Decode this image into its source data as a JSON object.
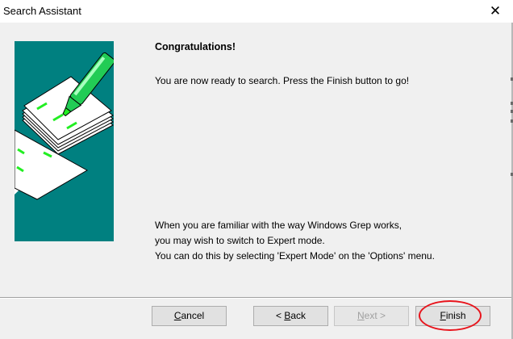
{
  "window": {
    "title": "Search Assistant",
    "close_glyph": "✕"
  },
  "content": {
    "heading": "Congratulations!",
    "intro": "You are now ready to search. Press the Finish button to go!",
    "hint_lines": [
      "When you are familiar with the way Windows Grep works,",
      "you may wish to switch to Expert mode.",
      "You can do this by selecting 'Expert Mode' on the 'Options' menu."
    ]
  },
  "buttons": {
    "cancel": {
      "mnemonic": "C",
      "rest": "ancel"
    },
    "back": {
      "prefix": "< ",
      "mnemonic": "B",
      "rest": "ack"
    },
    "next": {
      "mnemonic": "N",
      "rest": "ext >",
      "enabled": false
    },
    "finish": {
      "mnemonic": "F",
      "rest": "inish"
    }
  },
  "colors": {
    "teal_panel": "#008080",
    "highlighter_green": "#22ee22",
    "annotation_ring": "#e8141c"
  },
  "icons": {
    "side_image": "highlighter-pen-papers-illustration",
    "close": "close-icon"
  }
}
